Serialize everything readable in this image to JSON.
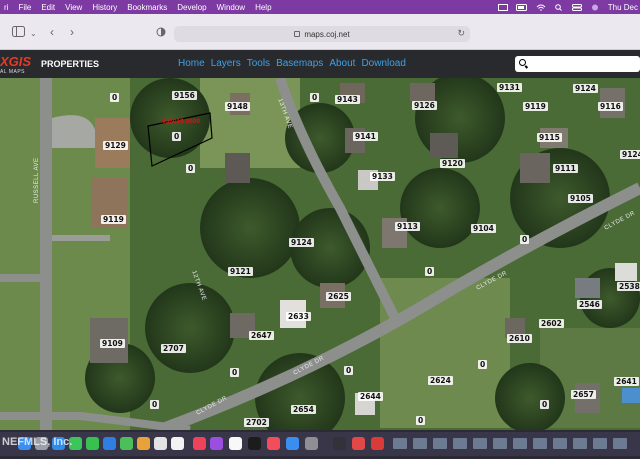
{
  "menubar": {
    "apple": "ri",
    "items": [
      "File",
      "Edit",
      "View",
      "History",
      "Bookmarks",
      "Develop",
      "Window",
      "Help"
    ],
    "clock": "Thu Dec"
  },
  "browser": {
    "url": "maps.coj.net"
  },
  "app": {
    "logo": "XGIS",
    "logo_sub": "AL MAPS",
    "title": "PROPERTIES",
    "nav": [
      "Home",
      "Layers",
      "Tools",
      "Basemaps",
      "About",
      "Download"
    ],
    "search_placeholder": ""
  },
  "map": {
    "parcels": [
      "9156",
      "9148",
      "9143",
      "9126",
      "9131",
      "9124",
      "9119",
      "9116",
      "9129",
      "0",
      "9141",
      "9115",
      "9120",
      "9111",
      "9124",
      "0",
      "9133",
      "9105",
      "9119",
      "9113",
      "9104",
      "9124",
      "9121",
      "0",
      "2625",
      "2633",
      "2647",
      "2546",
      "2538",
      "2707",
      "2610",
      "2602",
      "9109",
      "2624",
      "2644",
      "2657",
      "2641",
      "2654",
      "2702",
      "0",
      "0",
      "0",
      "0",
      "0",
      "0",
      "0",
      "0",
      "0"
    ],
    "streets": [
      "RUSSELL AVE",
      "13TH AVE",
      "12TH AVE",
      "CLYDE DR",
      "CLYDE DR",
      "CLYDE DR",
      "CLYDE DR"
    ],
    "highlight_label": "036019 0000"
  },
  "watermark": "NEFMLS, Inc."
}
